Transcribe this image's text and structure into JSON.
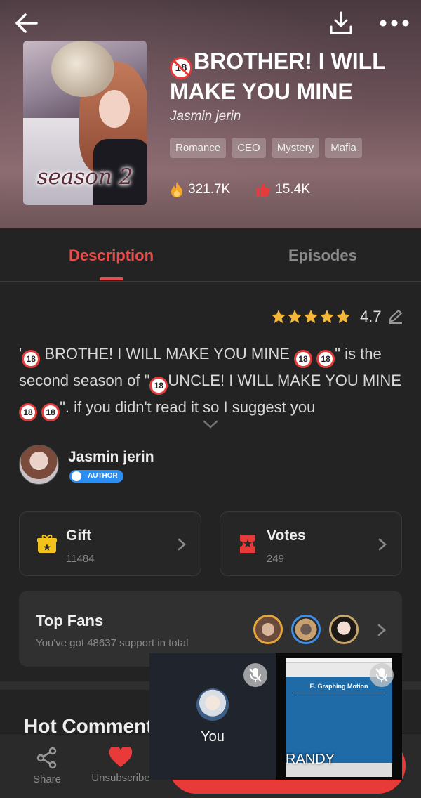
{
  "book": {
    "title": "BROTHER! I WILL MAKE YOU MINE",
    "age_badge": "18",
    "author": "Jasmin jerin",
    "cover_text": "season 2",
    "tags": [
      "Romance",
      "CEO",
      "Mystery",
      "Mafia"
    ],
    "views": "321.7K",
    "likes": "15.4K"
  },
  "tabs": {
    "description": "Description",
    "episodes": "Episodes"
  },
  "rating": {
    "value": "4.7",
    "stars": 5
  },
  "description": {
    "q1": "'",
    "p1": " BROTHE! I WILL MAKE YOU MINE ",
    "p2": "\" is the second season of \"",
    "p3": "UNCLE! I WILL MAKE YOU MINE ",
    "p4": "\".  if you didn't read it so I suggest you",
    "badge": "18"
  },
  "author_section": {
    "name": "Jasmin jerin",
    "badge": "AUTHOR"
  },
  "gift": {
    "label": "Gift",
    "count": "11484"
  },
  "votes": {
    "label": "Votes",
    "count": "249"
  },
  "top_fans": {
    "title": "Top Fans",
    "subtitle": "You've got 48637 support in total"
  },
  "hot_comments": "Hot Comment",
  "bottom_bar": {
    "share": "Share",
    "unsubscribe": "Unsubscribe"
  },
  "call": {
    "you": "You",
    "randy": "RANDY",
    "slide_title": "E. Graphing Motion"
  },
  "colors": {
    "accent": "#ef4a4a",
    "background": "#232323",
    "star": "#f5b73b"
  }
}
